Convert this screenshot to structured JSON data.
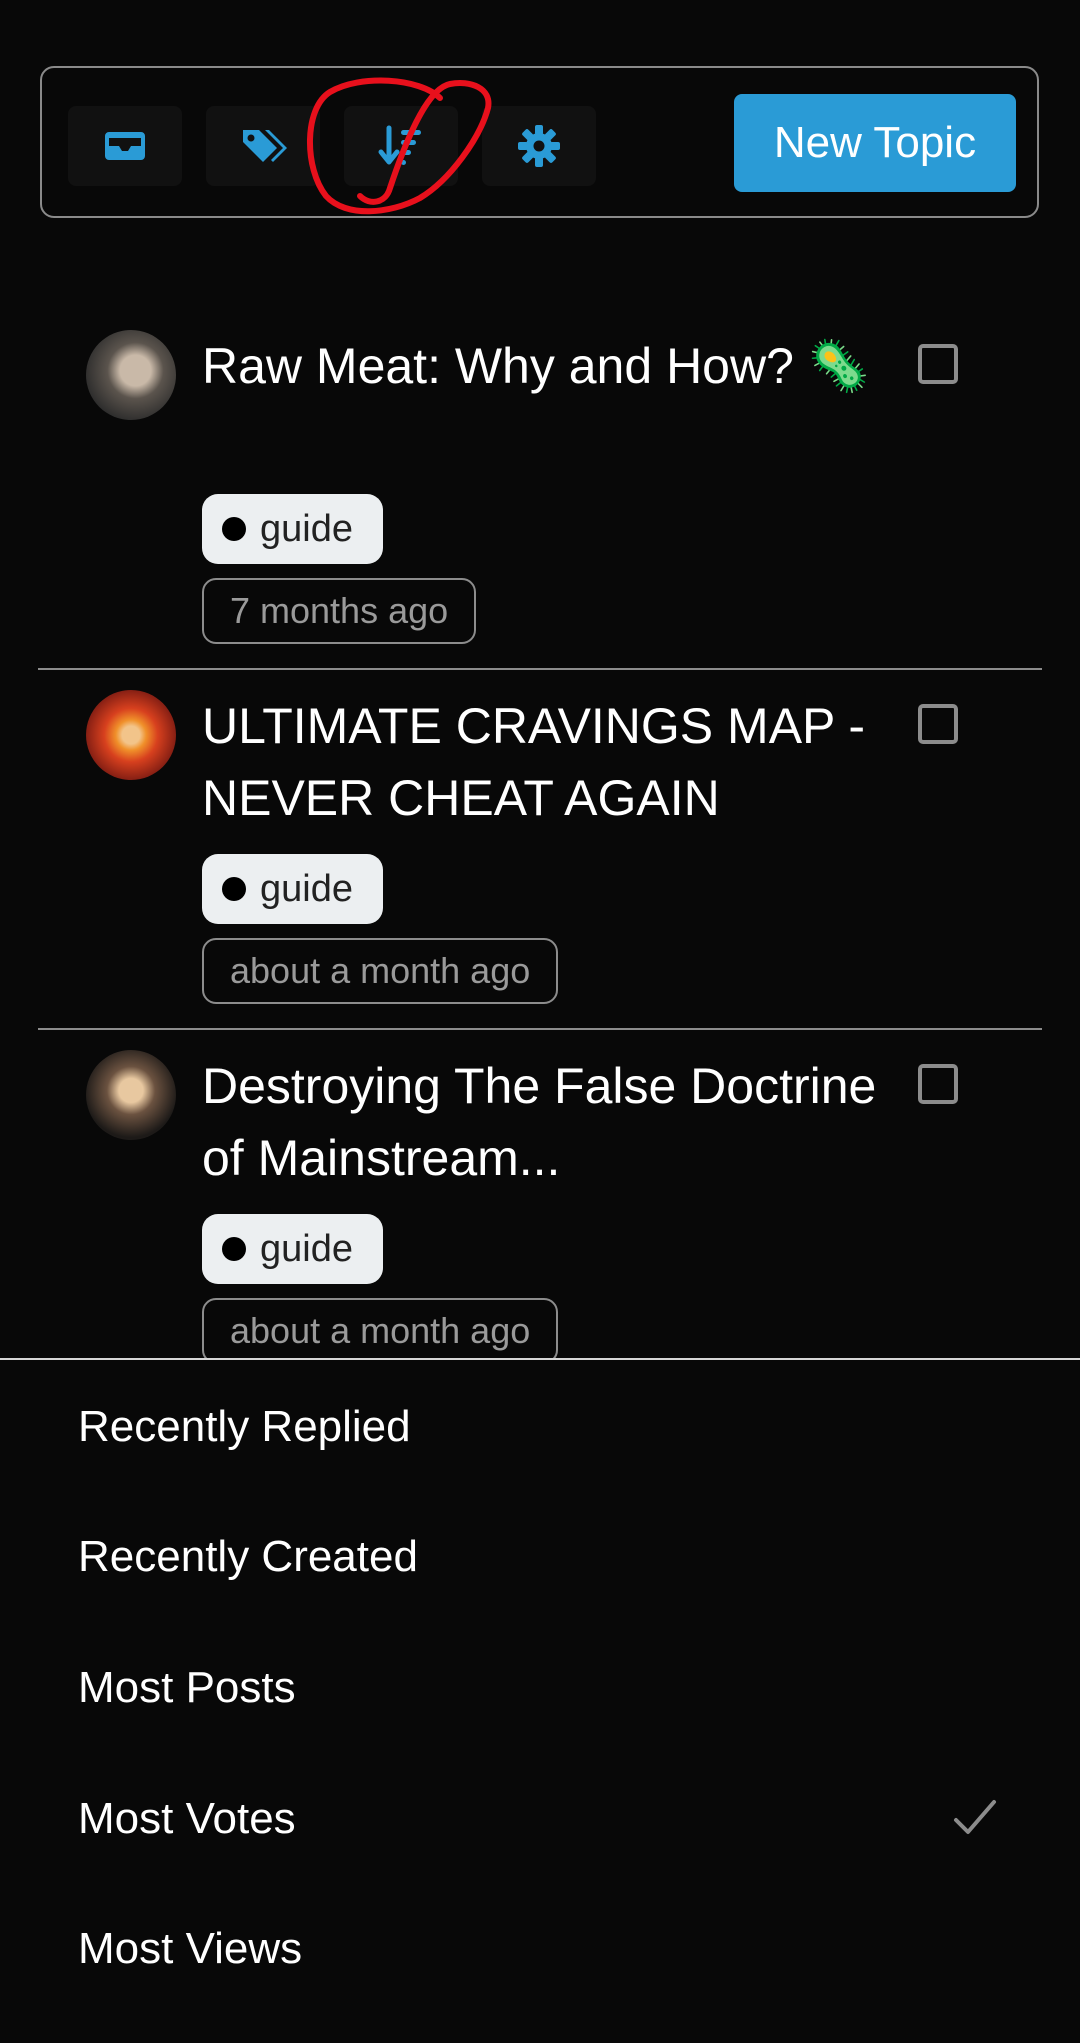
{
  "toolbar": {
    "buttons": [
      {
        "name": "inbox-icon",
        "label": ""
      },
      {
        "name": "tags-icon",
        "label": ""
      },
      {
        "name": "sort-icon",
        "label": ""
      },
      {
        "name": "gear-icon",
        "label": ""
      }
    ],
    "new_topic_label": "New Topic",
    "accent_color": "#2a9bd6"
  },
  "topics": [
    {
      "title": "Raw Meat: Why and How? 🦠",
      "tag": "guide",
      "time": "7 months ago"
    },
    {
      "title": "ULTIMATE CRAVINGS MAP - NEVER CHEAT AGAIN",
      "tag": "guide",
      "time": "about a month ago"
    },
    {
      "title": "Destroying The False Doctrine of Mainstream...",
      "tag": "guide",
      "time": "about a month ago"
    }
  ],
  "sort_menu": {
    "options": [
      {
        "label": "Recently Replied",
        "selected": false
      },
      {
        "label": "Recently Created",
        "selected": false
      },
      {
        "label": "Most Posts",
        "selected": false
      },
      {
        "label": "Most Votes",
        "selected": true
      },
      {
        "label": "Most Views",
        "selected": false
      }
    ],
    "selected_icon": "checkmark-icon"
  },
  "annotation_color": "#e8101c"
}
